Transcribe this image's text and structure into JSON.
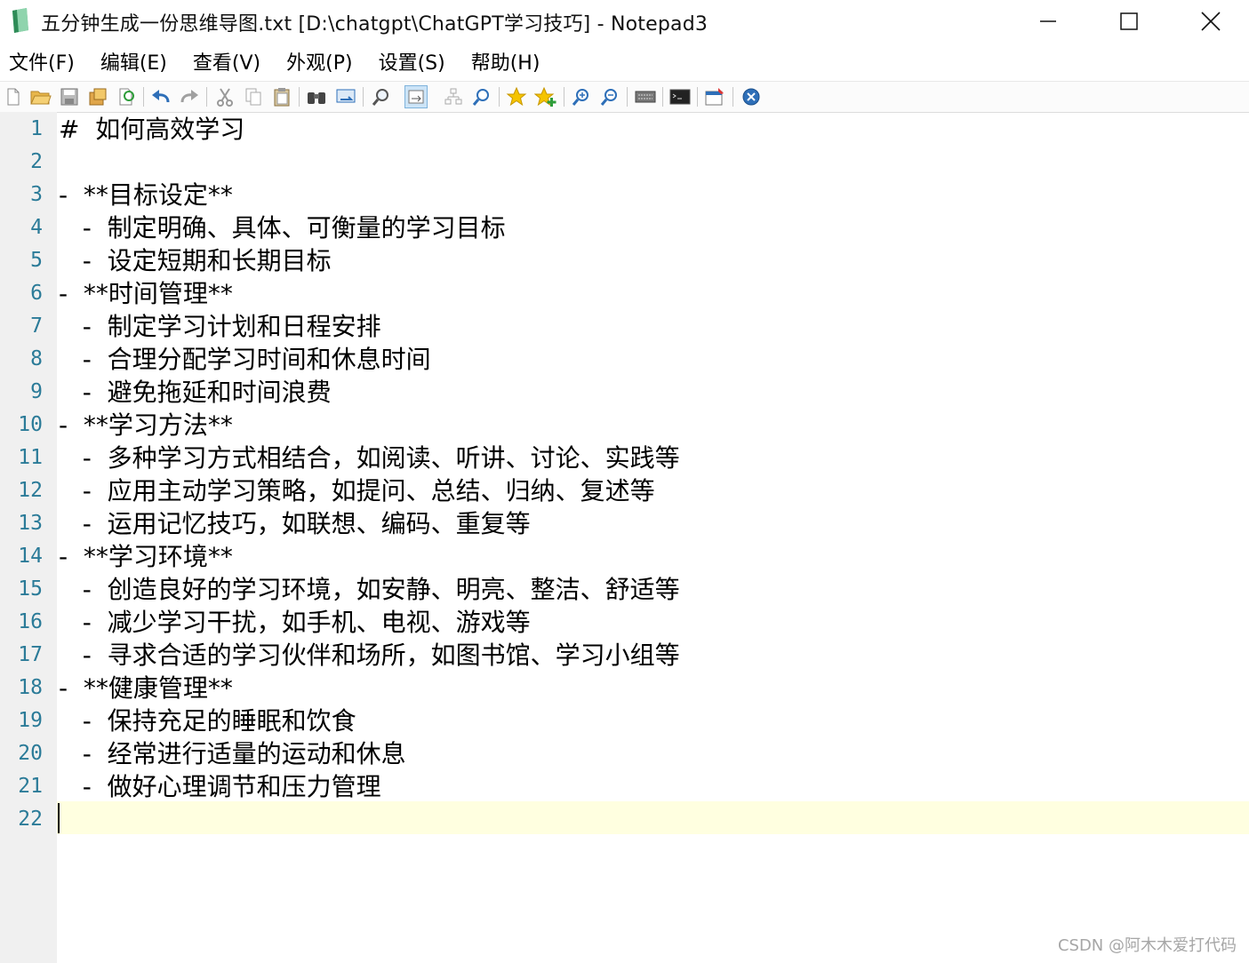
{
  "window": {
    "title": "五分钟生成一份思维导图.txt [D:\\chatgpt\\ChatGPT学习技巧] - Notepad3"
  },
  "menu": [
    "文件(F)",
    "编辑(E)",
    "查看(V)",
    "外观(P)",
    "设置(S)",
    "帮助(H)"
  ],
  "toolbar": [
    "new-file-icon",
    "open-folder-icon",
    "save-icon",
    "save-as-icon",
    "refresh-icon",
    "undo-icon",
    "redo-icon",
    "cut-icon",
    "copy-icon",
    "paste-icon",
    "find-icon",
    "replace-icon",
    "zoom-find-icon",
    "word-wrap-icon",
    "indent-guides-icon",
    "find-next-icon",
    "bookmark-star-icon",
    "add-bookmark-icon",
    "zoom-in-icon",
    "zoom-out-icon",
    "keyboard-icon",
    "terminal-icon",
    "pin-window-icon",
    "exit-icon"
  ],
  "editor": {
    "current_line": 22,
    "lines": [
      {
        "n": "1",
        "text": "#  如何高效学习"
      },
      {
        "n": "2",
        "text": ""
      },
      {
        "n": "3",
        "text": "-  **目标设定**"
      },
      {
        "n": "4",
        "text": "   -  制定明确、具体、可衡量的学习目标"
      },
      {
        "n": "5",
        "text": "   -  设定短期和长期目标"
      },
      {
        "n": "6",
        "text": "-  **时间管理**"
      },
      {
        "n": "7",
        "text": "   -  制定学习计划和日程安排"
      },
      {
        "n": "8",
        "text": "   -  合理分配学习时间和休息时间"
      },
      {
        "n": "9",
        "text": "   -  避免拖延和时间浪费"
      },
      {
        "n": "10",
        "text": "-  **学习方法**"
      },
      {
        "n": "11",
        "text": "   -  多种学习方式相结合，如阅读、听讲、讨论、实践等"
      },
      {
        "n": "12",
        "text": "   -  应用主动学习策略，如提问、总结、归纳、复述等"
      },
      {
        "n": "13",
        "text": "   -  运用记忆技巧，如联想、编码、重复等"
      },
      {
        "n": "14",
        "text": "-  **学习环境**"
      },
      {
        "n": "15",
        "text": "   -  创造良好的学习环境，如安静、明亮、整洁、舒适等"
      },
      {
        "n": "16",
        "text": "   -  减少学习干扰，如手机、电视、游戏等"
      },
      {
        "n": "17",
        "text": "   -  寻求合适的学习伙伴和场所，如图书馆、学习小组等"
      },
      {
        "n": "18",
        "text": "-  **健康管理**"
      },
      {
        "n": "19",
        "text": "   -  保持充足的睡眠和饮食"
      },
      {
        "n": "20",
        "text": "   -  经常进行适量的运动和休息"
      },
      {
        "n": "21",
        "text": "   -  做好心理调节和压力管理"
      },
      {
        "n": "22",
        "text": ""
      }
    ]
  },
  "watermark": "CSDN @阿木木爱打代码"
}
